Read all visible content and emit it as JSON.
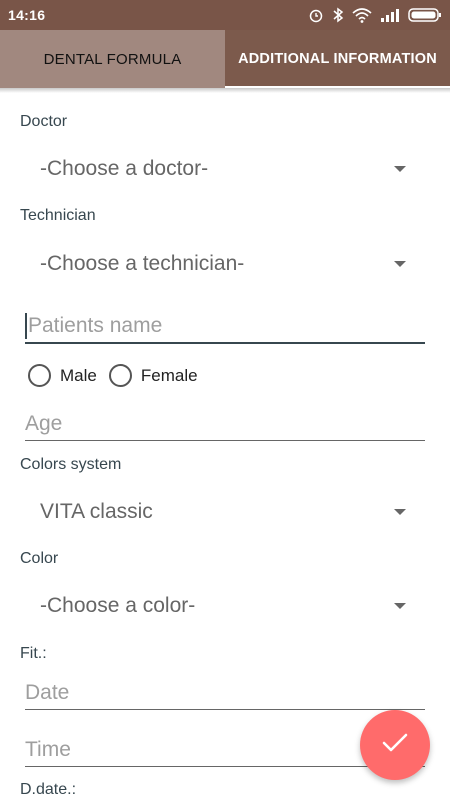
{
  "status_bar": {
    "time": "14:16",
    "icons": [
      "alarm-icon",
      "bluetooth-icon",
      "wifi-icon",
      "signal-icon",
      "battery-icon"
    ]
  },
  "tabs": {
    "active_index": 0,
    "items": [
      {
        "label": "DENTAL FORMULA"
      },
      {
        "label": "ADDITIONAL INFORMATION"
      }
    ]
  },
  "form": {
    "doctor": {
      "label": "Doctor",
      "value": "-Choose a doctor-"
    },
    "technician": {
      "label": "Technician",
      "value": "-Choose a technician-"
    },
    "patient_name": {
      "placeholder": "Patients name"
    },
    "gender": {
      "male_label": "Male",
      "female_label": "Female"
    },
    "age": {
      "placeholder": "Age"
    },
    "colors_system": {
      "label": "Colors system",
      "value": "VITA classic"
    },
    "color": {
      "label": "Color",
      "value": "-Choose a color-"
    },
    "fit": {
      "label": "Fit.:",
      "date_placeholder": "Date",
      "time_placeholder": "Time"
    },
    "d_date": {
      "label": "D.date.:"
    }
  },
  "fab": {
    "icon": "check-icon",
    "color": "#ff6b6b"
  },
  "colors": {
    "primary": "#795548",
    "tab_active": "#a1887f",
    "accent": "#37474f"
  }
}
